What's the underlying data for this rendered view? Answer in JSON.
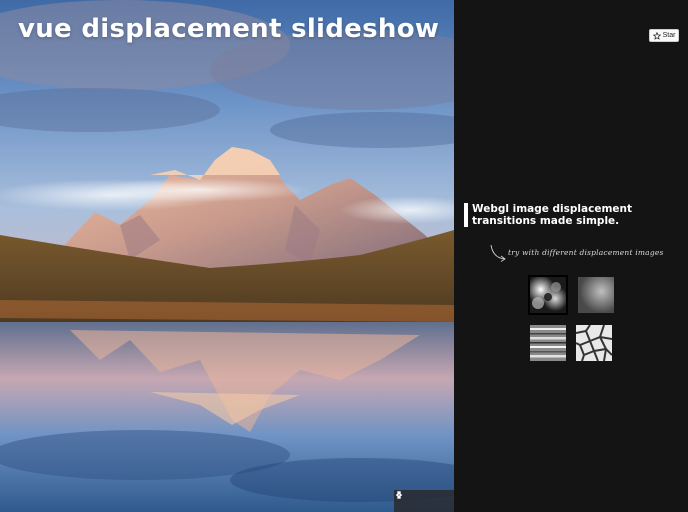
{
  "hero": {
    "title": "vue displacement slideshow",
    "prev_icon": "chevron-left-icon",
    "next_icon": "chevron-right-icon"
  },
  "github": {
    "star_label": "Star",
    "star_icon": "star-icon"
  },
  "intro": {
    "tagline_line1": "Webgl image displacement",
    "tagline_line2": "transitions made simple.",
    "hint": "try with different displacement images"
  },
  "displacement_maps": [
    {
      "name": "cloud-noise",
      "active": true
    },
    {
      "name": "soft-grain",
      "active": false
    },
    {
      "name": "streaks",
      "active": false
    },
    {
      "name": "cells",
      "active": false
    }
  ],
  "colors": {
    "panel_bg": "#141414",
    "text": "#ffffff"
  }
}
